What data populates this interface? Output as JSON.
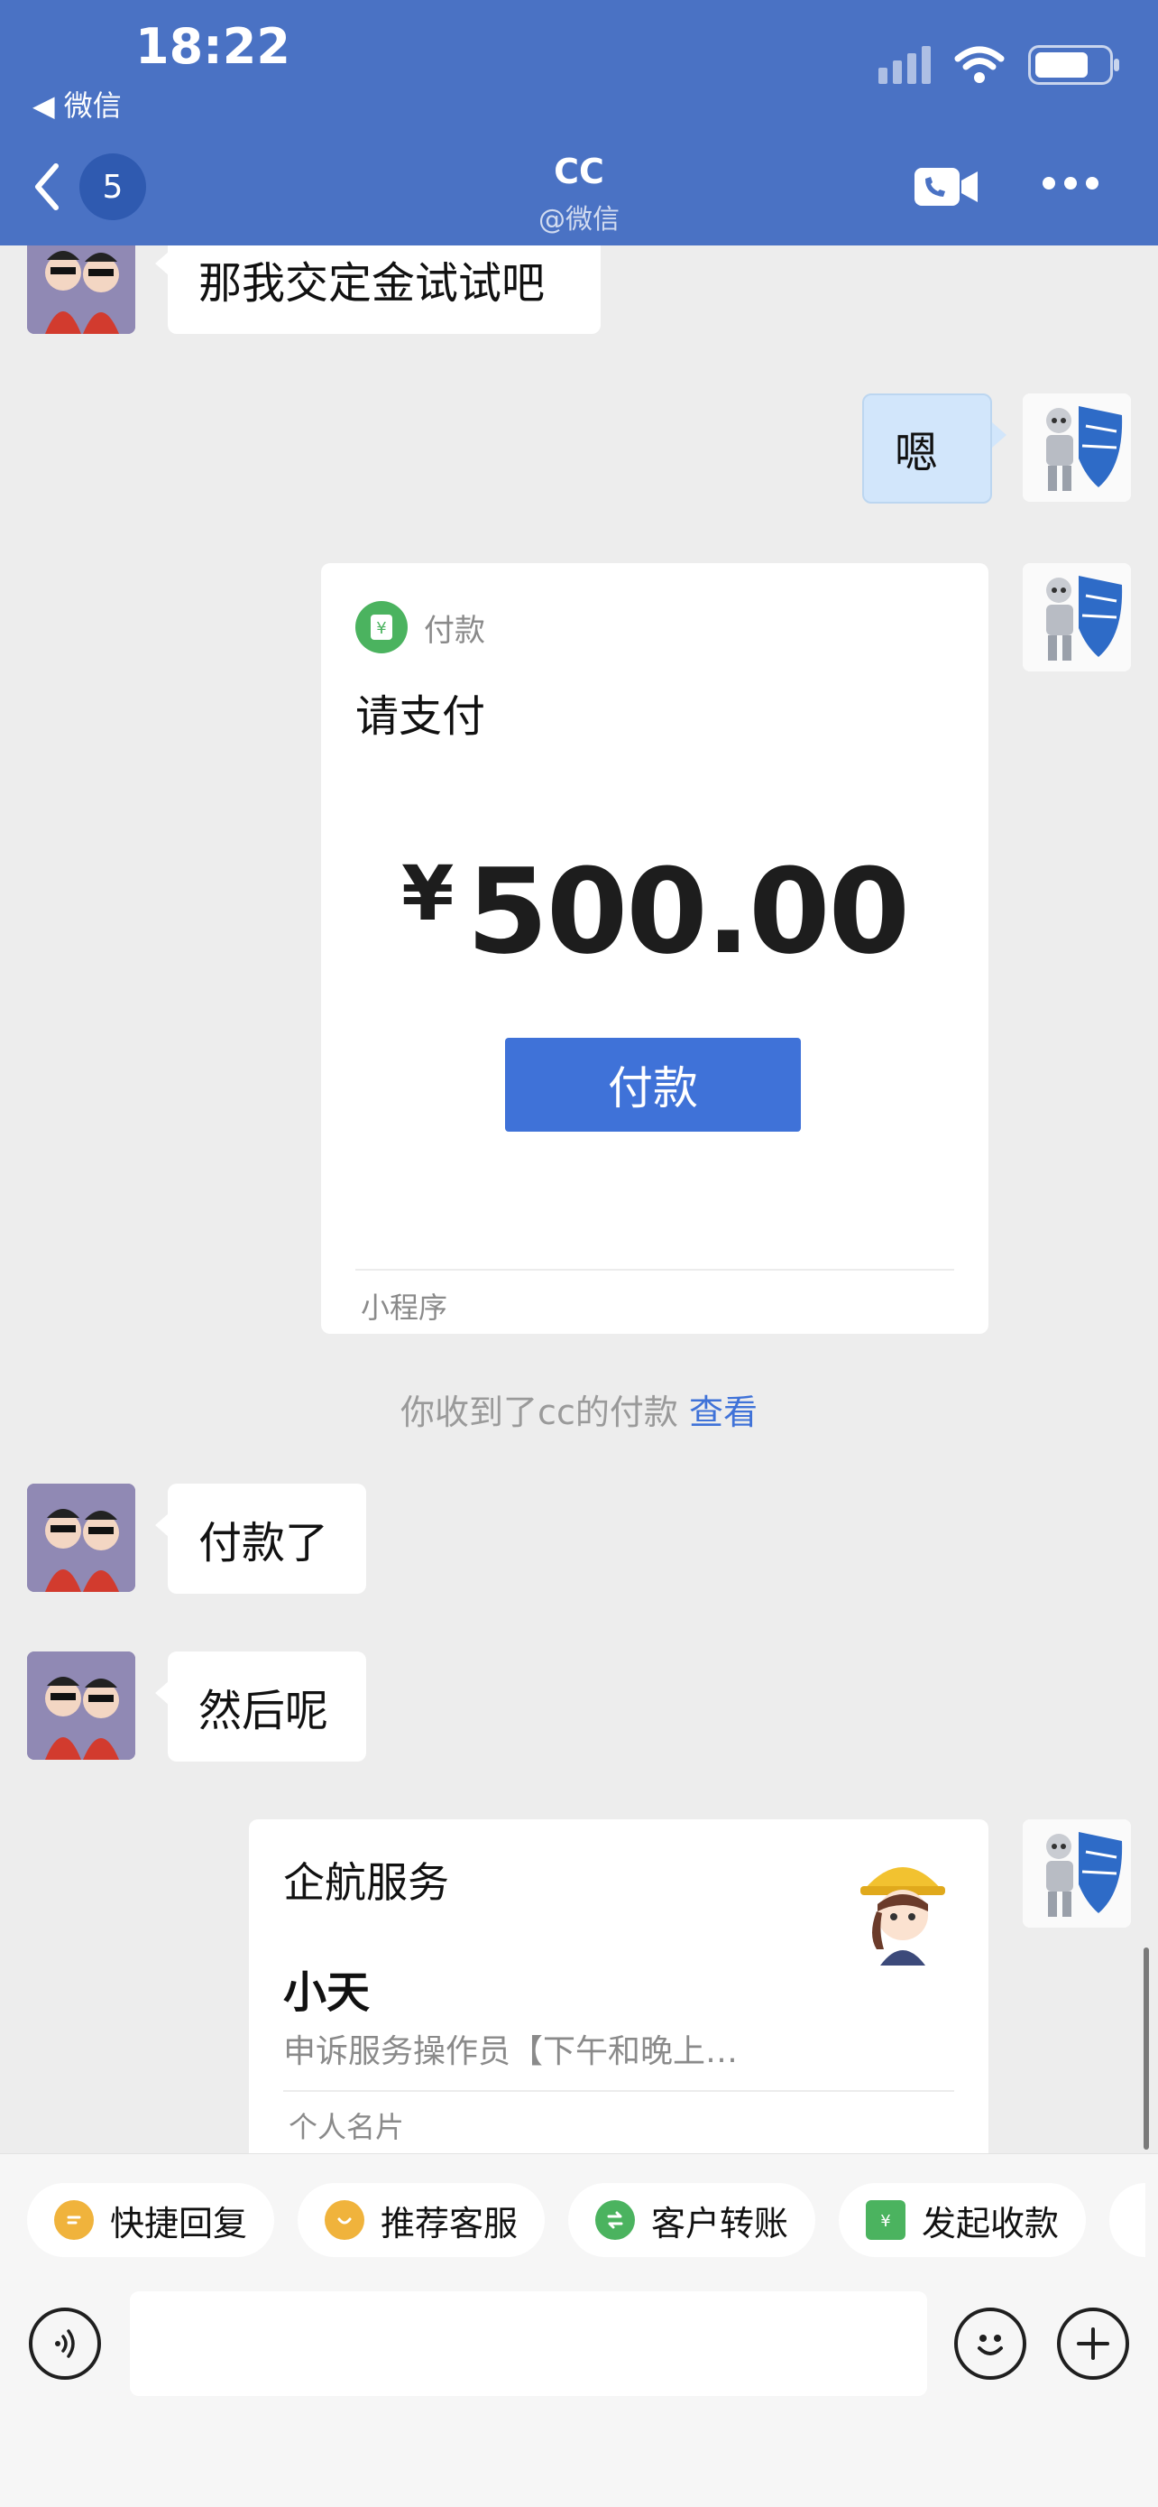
{
  "status": {
    "time": "18:22",
    "back_app": "◀ 微信"
  },
  "nav": {
    "unread_count": "5",
    "title": "CC",
    "subtitle": "@微信"
  },
  "messages": {
    "m1": "那我交定金试试吧",
    "m2": "嗯",
    "m3": "付款了",
    "m4": "然后呢"
  },
  "payment_card": {
    "header": "付款",
    "title": "请支付",
    "currency": "¥",
    "amount": "500.00",
    "button": "付款",
    "footer": "小程序"
  },
  "system_notice": {
    "text": "你收到了cc的付款",
    "link": "查看"
  },
  "contact_card": {
    "org": "企航服务",
    "name": "小天",
    "desc": "申诉服务操作员【下午和晚上…",
    "footer": "个人名片"
  },
  "quick_actions": [
    {
      "label": "快捷回复",
      "color": "#f0b33c"
    },
    {
      "label": "推荐客服",
      "color": "#f0b33c"
    },
    {
      "label": "客户转账",
      "color": "#4bb35f"
    },
    {
      "label": "发起收款",
      "color": "#4bb35f"
    }
  ],
  "colors": {
    "header_bg": "#4a72c4",
    "accent_blue": "#3f72d8",
    "chat_bg": "#ededed"
  }
}
